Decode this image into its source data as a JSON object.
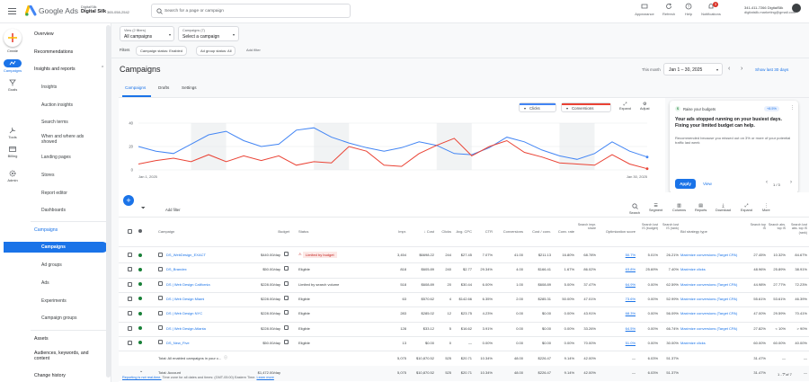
{
  "header": {
    "app_name": "Google Ads",
    "account_label": "DigitalSilk",
    "account_name": "Digital Silk",
    "account_id": "365-058-2542",
    "search_placeholder": "Search for a page or campaign",
    "appearance": "Appearance",
    "refresh": "Refresh",
    "help": "Help",
    "notifications": "Notifications",
    "notif_count": "3",
    "user_line1": "341-411-7266 DigitalSilk",
    "user_line2": "digitalsilk.marketing@gmail.com"
  },
  "rail": {
    "create": "Create",
    "campaigns": "Campaigns",
    "goals": "Goals",
    "tools": "Tools",
    "billing": "Billing",
    "admin": "Admin"
  },
  "nav": {
    "overview": "Overview",
    "recommendations": "Recommendations",
    "insights_reports": "Insights and reports",
    "insights": "Insights",
    "auction_insights": "Auction insights",
    "search_terms": "Search terms",
    "when_where": "When and where ads showed",
    "landing_pages": "Landing pages",
    "stores": "Stores",
    "report_editor": "Report editor",
    "dashboards": "Dashboards",
    "campaigns_section": "Campaigns",
    "campaigns": "Campaigns",
    "ad_groups": "Ad groups",
    "ads": "Ads",
    "experiments": "Experiments",
    "campaign_groups": "Campaign groups",
    "assets": "Assets",
    "audiences": "Audiences, keywords, and content",
    "change_history": "Change history"
  },
  "selectors": {
    "view_label": "View (2 filters)",
    "view_value": "All campaigns",
    "campaigns_label": "Campaigns (7)",
    "campaigns_value": "Select a campaign"
  },
  "filters": {
    "label": "Filters",
    "chip1": "Campaign status: Enabled",
    "chip2": "Ad group status: All",
    "add": "Add filter"
  },
  "page": {
    "title": "Campaigns",
    "date_prefix": "This month",
    "date_range": "Jan 1 – 30, 2025",
    "show_last": "Show last 30 days",
    "tabs": [
      "Campaigns",
      "Drafts",
      "Settings"
    ]
  },
  "chart_controls": {
    "metric1": "Clicks",
    "metric2": "Conversions",
    "expand": "Expand",
    "adjust": "Adjust",
    "metric1_color": "#4285f4",
    "metric2_color": "#ea4335"
  },
  "chart_data": {
    "type": "line",
    "x_start": "Jan 1, 2025",
    "x_end": "Jan 30, 2025",
    "y_ticks": [
      "40",
      "20",
      "0"
    ],
    "ylim": [
      0,
      40
    ],
    "series": [
      {
        "name": "Clicks",
        "color": "#4285f4",
        "values": [
          20,
          16,
          14,
          22,
          30,
          33,
          25,
          20,
          22,
          34,
          36,
          28,
          23,
          19,
          16,
          19,
          24,
          21,
          14,
          13,
          19,
          28,
          24,
          17,
          12,
          9,
          14,
          24,
          16,
          11
        ]
      },
      {
        "name": "Conversions",
        "color": "#ea4335",
        "values": [
          5,
          8,
          10,
          7,
          13,
          7,
          12,
          8,
          12,
          4,
          7,
          6,
          20,
          16,
          4,
          3,
          14,
          21,
          27,
          12,
          20,
          25,
          15,
          11,
          6,
          5,
          4,
          13,
          5,
          1
        ]
      }
    ]
  },
  "promo": {
    "title": "Raise your budgets",
    "badge": "+8.5%",
    "headline": "Your ads stopped running on your busiest days. Fixing your limited budget can help.",
    "body": "Recommended because you missed out on 3% or more of your potential traffic last week",
    "apply": "Apply",
    "view": "View",
    "pager": "1 / 3"
  },
  "toolbar": {
    "filter": "Add filter",
    "search": "Search",
    "segment": "Segment",
    "columns": "Columns",
    "reports": "Reports",
    "download": "Download",
    "expand": "Expand",
    "more": "More"
  },
  "table": {
    "headers": {
      "campaign": "Campaign",
      "budget": "Budget",
      "status": "Status",
      "impr": "Impr.",
      "cost": "↓ Cost",
      "clicks": "Clicks",
      "avg_cpc": "Avg. CPC",
      "ctr": "CTR",
      "conversions": "Conversions",
      "cost_conv": "Cost / conv.",
      "conv_rate": "Conv. rate",
      "imp_share": "Search impr. share",
      "opt_score": "Optimization score",
      "lost_budget": "Search lost IS (budget)",
      "lost_rank": "Search lost IS (rank)",
      "bid": "Bid strategy type",
      "top_is": "Search top IS",
      "abs_top_is": "Search abs. top IS",
      "lost_abs_top": "Search lost abs. top IS (rank)"
    },
    "rows": [
      {
        "name": "DS_WebDesign_EXACT",
        "budget": "$440.00/day",
        "status": "Limited by budget",
        "status_flag": "warn",
        "impr": "3,454",
        "cost": "$6698.22",
        "clicks": "244",
        "cpc": "$27.45",
        "ctr": "7.07%",
        "conv": "41.00",
        "cost_conv": "$211.13",
        "conv_rate": "16.80%",
        "imp_share": "68.78%",
        "opt": "50.7%",
        "lost_budget": "5.01%",
        "lost_rank": "26.21%",
        "bid": "Maximize conversions (Target CPA)",
        "top": "27.45%",
        "abs": "10.32%",
        "lost_abs": "84.67%"
      },
      {
        "name": "DS_Brandex",
        "budget": "$50.00/day",
        "status": "Eligible",
        "status_flag": "",
        "impr": "818",
        "cost": "$605.89",
        "clicks": "240",
        "cpc": "$2.77",
        "ctr": "29.34%",
        "conv": "4.00",
        "cost_conv": "$166.41",
        "conv_rate": "1.67%",
        "imp_share": "86.02%",
        "opt": "63.8%",
        "lost_budget": "25.69%",
        "lost_rank": "7.40%",
        "bid": "Maximize clicks",
        "top": "48.96%",
        "abs": "25.89%",
        "lost_abs": "38.91%"
      },
      {
        "name": "DS | Web Design California",
        "budget": "$228.00/day",
        "status": "Limited by search volume",
        "status_flag": "",
        "impr": "518",
        "cost": "$608.89",
        "clicks": "20",
        "cpc": "$30.44",
        "ctr": "6.00%",
        "conv": "1.00",
        "cost_conv": "$608.89",
        "conv_rate": "5.00%",
        "imp_share": "37.47%",
        "opt": "64.9%",
        "lost_budget": "0.00%",
        "lost_rank": "62.59%",
        "bid": "Maximize conversions (Target CPA)",
        "top": "44.98%",
        "abs": "27.77%",
        "lost_abs": "72.23%"
      },
      {
        "name": "DS | Web Design Miami",
        "budget": "$228.00/day",
        "status": "Eligible",
        "status_flag": "",
        "impr": "63",
        "cost": "$570.62",
        "clicks": "4",
        "cpc": "$142.66",
        "ctr": "6.35%",
        "conv": "2.00",
        "cost_conv": "$285.31",
        "conv_rate": "50.00%",
        "imp_share": "47.01%",
        "opt": "73.6%",
        "lost_budget": "0.00%",
        "lost_rank": "52.99%",
        "bid": "Maximize conversions (Target CPA)",
        "top": "55.61%",
        "abs": "53.61%",
        "lost_abs": "46.39%"
      },
      {
        "name": "DS | Web Design NYC",
        "budget": "$228.00/day",
        "status": "Eligible",
        "status_flag": "",
        "impr": "283",
        "cost": "$285.02",
        "clicks": "12",
        "cpc": "$23.75",
        "ctr": "4.23%",
        "conv": "0.00",
        "cost_conv": "$0.00",
        "conv_rate": "0.00%",
        "imp_share": "43.91%",
        "opt": "68.3%",
        "lost_budget": "0.00%",
        "lost_rank": "56.09%",
        "bid": "Maximize conversions (Target CPA)",
        "top": "47.00%",
        "abs": "29.59%",
        "lost_abs": "70.41%"
      },
      {
        "name": "DS | Web Design Atlanta",
        "budget": "$228.00/day",
        "status": "Eligible",
        "status_flag": "",
        "impr": "128",
        "cost": "$33.12",
        "clicks": "5",
        "cpc": "$16.62",
        "ctr": "3.91%",
        "conv": "0.00",
        "cost_conv": "$0.00",
        "conv_rate": "0.00%",
        "imp_share": "33.26%",
        "opt": "64.5%",
        "lost_budget": "0.00%",
        "lost_rank": "66.74%",
        "bid": "Maximize conversions (Target CPA)",
        "top": "27.82%",
        "abs": "< 10%",
        "lost_abs": "> 90%"
      },
      {
        "name": "DS_New_Five",
        "budget": "$50.00/day",
        "status": "Eligible",
        "status_flag": "",
        "impr": "13",
        "cost": "$0.00",
        "clicks": "0",
        "cpc": "—",
        "ctr": "0.00%",
        "conv": "0.00",
        "cost_conv": "$0.00",
        "conv_rate": "0.00%",
        "imp_share": "70.00%",
        "opt": "51.0%",
        "lost_budget": "0.00%",
        "lost_rank": "30.00%",
        "bid": "Maximize clicks",
        "top": "60.00%",
        "abs": "60.00%",
        "lost_abs": "40.00%"
      }
    ],
    "total_enabled": {
      "label": "Total: All enabled campaigns in your c...",
      "budget": "",
      "impr": "5,075",
      "cost": "$10,870.52",
      "clicks": "525",
      "cpc": "$20.71",
      "ctr": "10.34%",
      "conv": "48.00",
      "cost_conv": "$226.47",
      "conv_rate": "9.14%",
      "imp_share": "42.00%",
      "opt": "—",
      "lost_budget": "6.03%",
      "lost_rank": "51.37%",
      "top": "31.47%",
      "abs": "—",
      "lost_abs": "—"
    },
    "total_account": {
      "label": "Total: Account",
      "budget": "$1,472.00/day",
      "impr": "5,075",
      "cost": "$10,870.52",
      "clicks": "525",
      "cpc": "$20.71",
      "ctr": "10.34%",
      "conv": "48.00",
      "cost_conv": "$226.47",
      "conv_rate": "9.14%",
      "imp_share": "42.00%",
      "opt": "—",
      "lost_budget": "6.03%",
      "lost_rank": "51.37%",
      "top": "31.47%",
      "abs": "—",
      "lost_abs": "—"
    },
    "pager": "1 - 7 of 7"
  },
  "footer": {
    "text1": "Reporting is not real-time.",
    "text2": "Time zone for all dates and times: (GMT-05:00) Eastern Time.",
    "learn": "Learn more"
  }
}
